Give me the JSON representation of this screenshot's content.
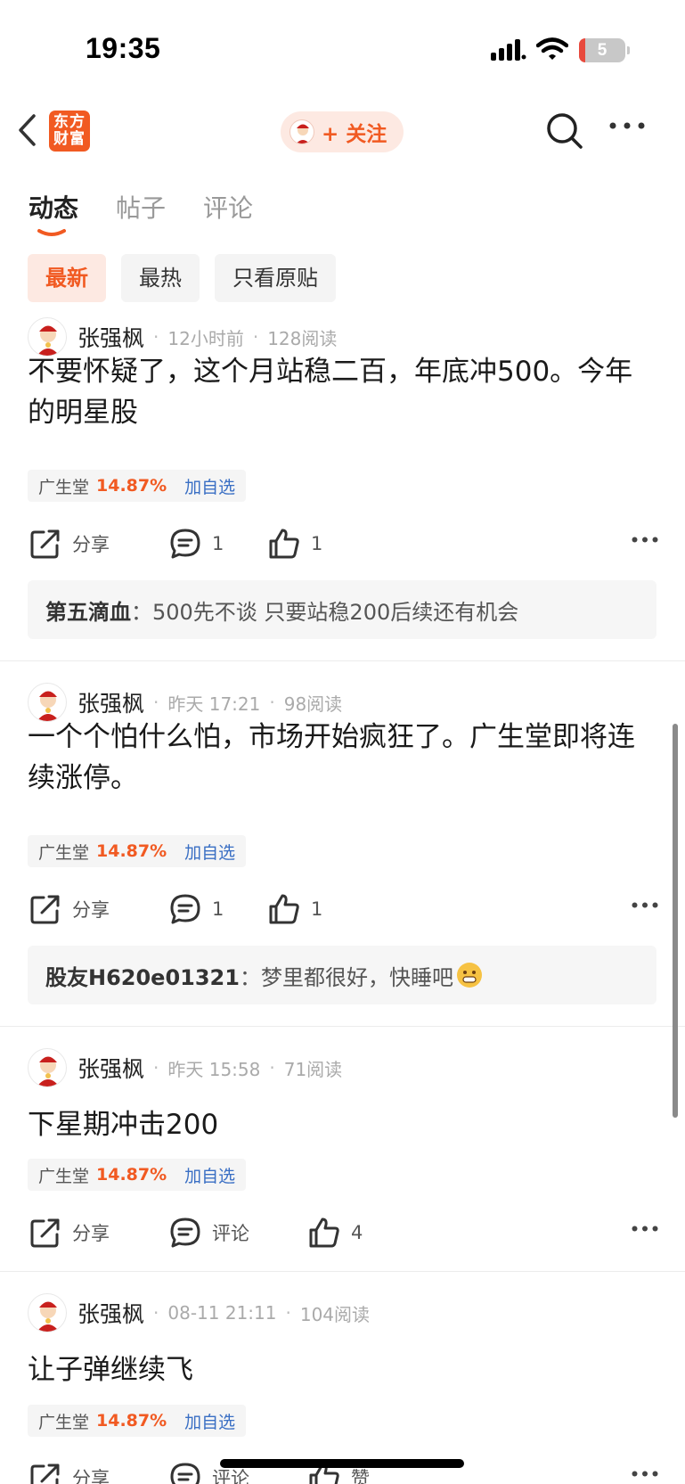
{
  "status_bar": {
    "time": "19:35",
    "battery": "5"
  },
  "header": {
    "brand_text": "东方\n财富",
    "follow_label": "+ 关注"
  },
  "tabs": [
    {
      "label": "动态",
      "active": true
    },
    {
      "label": "帖子",
      "active": false
    },
    {
      "label": "评论",
      "active": false
    }
  ],
  "filters": [
    {
      "label": "最新",
      "active": true
    },
    {
      "label": "最热",
      "active": false
    },
    {
      "label": "只看原贴",
      "active": false
    }
  ],
  "posts": [
    {
      "author": "张强枫",
      "time": "12小时前",
      "reads": "128阅读",
      "body": "不要怀疑了，这个月站稳二百，年底冲500。今年的明星股",
      "stock": {
        "name": "广生堂",
        "change": "14.87%",
        "add": "加自选"
      },
      "actions": {
        "share": "分享",
        "comments": "1",
        "likes": "1"
      },
      "reply": {
        "user": "第五滴血",
        "text": "500先不谈 只要站稳200后续还有机会"
      }
    },
    {
      "author": "张强枫",
      "time": "昨天 17:21",
      "reads": "98阅读",
      "body": "一个个怕什么怕，市场开始疯狂了。广生堂即将连续涨停。",
      "stock": {
        "name": "广生堂",
        "change": "14.87%",
        "add": "加自选"
      },
      "actions": {
        "share": "分享",
        "comments": "1",
        "likes": "1"
      },
      "reply": {
        "user": "股友H620e01321",
        "text": "梦里都很好，快睡吧"
      }
    },
    {
      "author": "张强枫",
      "time": "昨天 15:58",
      "reads": "71阅读",
      "body": "下星期冲击200",
      "stock": {
        "name": "广生堂",
        "change": "14.87%",
        "add": "加自选"
      },
      "actions": {
        "share": "分享",
        "comments": "评论",
        "likes": "4"
      }
    },
    {
      "author": "张强枫",
      "time": "08-11 21:11",
      "reads": "104阅读",
      "body": "让子弹继续飞",
      "stock": {
        "name": "广生堂",
        "change": "14.87%",
        "add": "加自选"
      },
      "actions": {
        "share": "分享",
        "comments": "评论",
        "likes": "赞"
      }
    }
  ],
  "colors": {
    "accent": "#f15a22",
    "link": "#3a6fc4",
    "reply_bg": "#f6f6f6"
  }
}
